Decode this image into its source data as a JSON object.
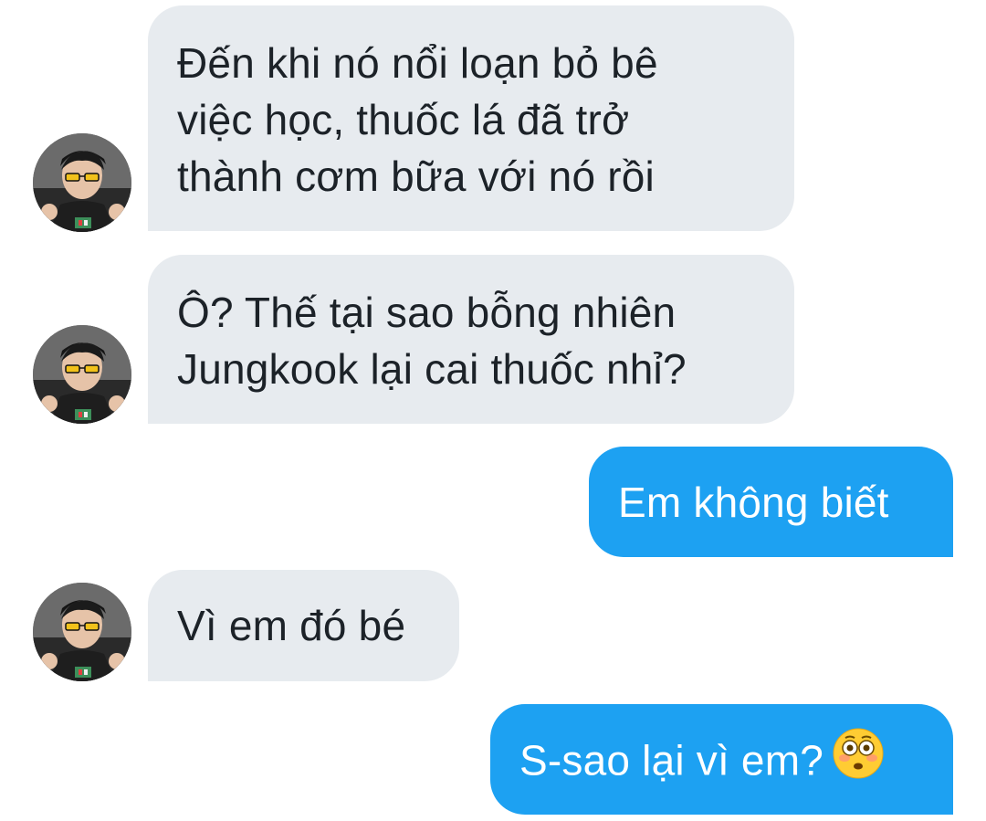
{
  "conversation": {
    "messages": [
      {
        "direction": "incoming",
        "lines": [
          "Đến khi nó nổi loạn bỏ bê",
          "việc học, thuốc lá đã trở",
          "thành cơm bữa với nó rồi"
        ]
      },
      {
        "direction": "incoming",
        "lines": [
          "Ô? Thế tại sao bỗng nhiên",
          "Jungkook lại cai thuốc nhỉ?"
        ]
      },
      {
        "direction": "outgoing",
        "lines": [
          "Em không biết"
        ]
      },
      {
        "direction": "incoming",
        "lines": [
          "Vì em đó bé"
        ]
      },
      {
        "direction": "outgoing",
        "lines": [
          "S-sao lại vì em?"
        ],
        "emoji": "flushed-face-icon"
      }
    ]
  },
  "colors": {
    "incoming_bubble": "#e7ebef",
    "incoming_text": "#1c2228",
    "outgoing_bubble": "#1da1f2",
    "outgoing_text": "#ffffff"
  }
}
